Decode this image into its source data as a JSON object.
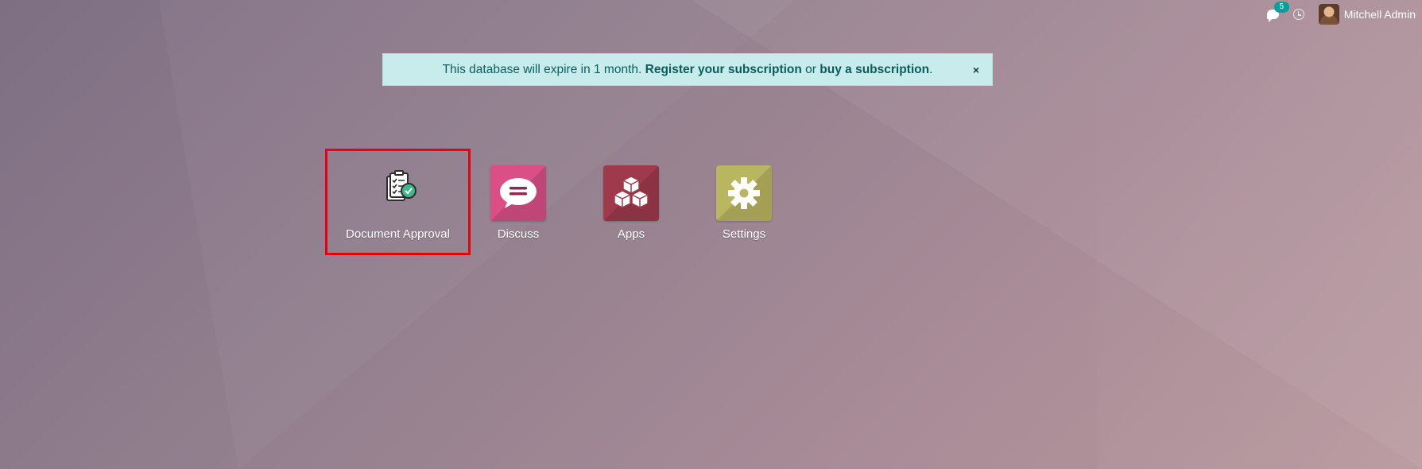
{
  "systray": {
    "messages_badge": "5",
    "user_name": "Mitchell Admin"
  },
  "banner": {
    "text_before": "This database will expire in 1 month.",
    "register_link": "Register your subscription",
    "middle_text": "or",
    "buy_link": "buy a subscription",
    "end_text": ".",
    "close_label": "×"
  },
  "apps": [
    {
      "label": "Document Approval",
      "icon": "document-approval-icon"
    },
    {
      "label": "Discuss",
      "icon": "chat-bubble-icon"
    },
    {
      "label": "Apps",
      "icon": "cubes-icon"
    },
    {
      "label": "Settings",
      "icon": "gear-icon"
    }
  ],
  "colors": {
    "banner_bg": "#c8ecec",
    "banner_text": "#09605e",
    "badge": "#00a09d",
    "selection_outline": "#e8000f",
    "discuss": "#d94f86",
    "apps": "#9e3a4b",
    "settings": "#b9b662"
  }
}
